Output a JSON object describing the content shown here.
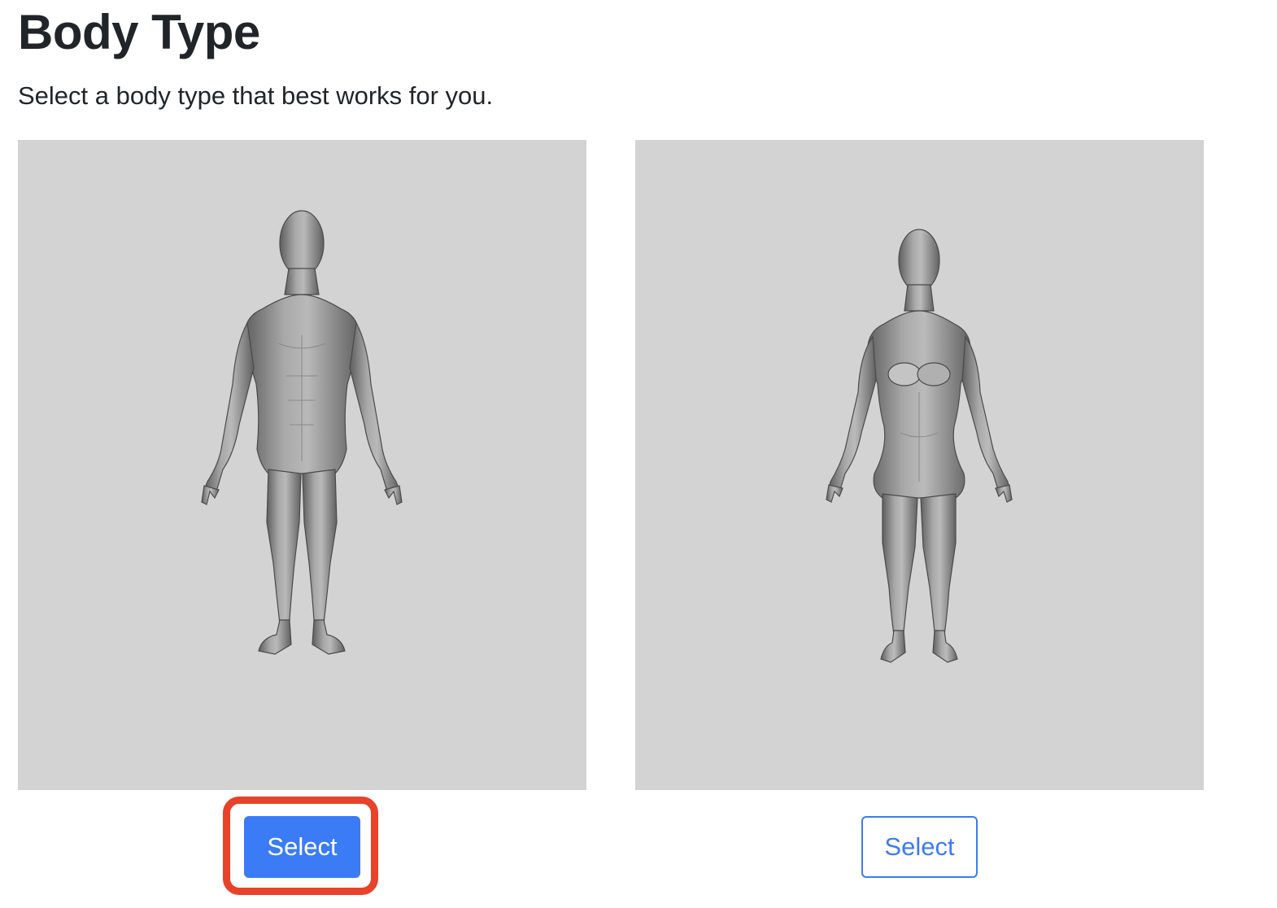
{
  "page": {
    "title": "Body Type",
    "subtitle": "Select a body type that best works for you."
  },
  "cards": [
    {
      "figure": "male-body-model",
      "button_label": "Select",
      "button_style": "primary",
      "highlighted": true
    },
    {
      "figure": "female-body-model",
      "button_label": "Select",
      "button_style": "outline",
      "highlighted": false
    }
  ],
  "colors": {
    "accent": "#3b7bf6",
    "image_background": "#d3d3d3",
    "highlight": "#e8422a",
    "figure_light": "#b8b8b8",
    "figure_dark": "#555555"
  }
}
